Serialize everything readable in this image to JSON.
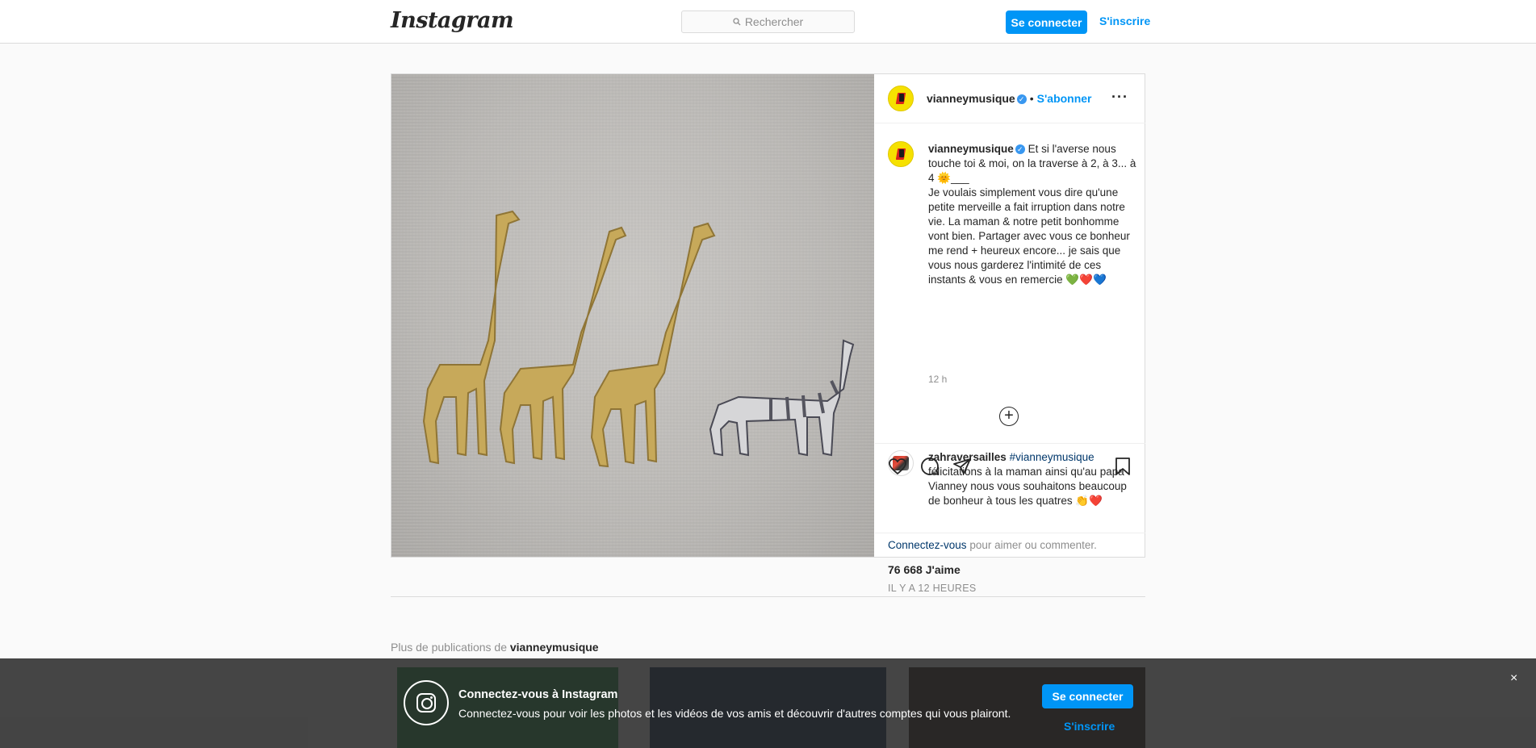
{
  "header": {
    "logo": "Instagram",
    "search_placeholder": "Rechercher",
    "login_label": "Se connecter",
    "signup_label": "S'inscrire"
  },
  "post": {
    "username": "vianneymusique",
    "follow_label": "S'abonner",
    "caption_user": "vianneymusique",
    "caption_line1": "Et si l'averse nous touche toi & moi, on la traverse à 2, à 3... à 4 🌞___",
    "caption_body": "Je voulais simplement vous dire qu'une petite merveille a fait irruption dans notre vie. La maman & notre petit bonhomme vont bien. Partager avec vous ce bonheur me rend + heureux encore... je sais que vous nous garderez l'intimité de ces instants & vous en remercie 💚❤️💙",
    "caption_time": "12 h",
    "comment": {
      "username": "zahraversailles",
      "hashtag": "#vianneymusique",
      "text": "félicitations à la maman ainsi qu'au papa Vianney nous vous souhaitons beaucoup de bonheur à tous les quatres 👏❤️"
    },
    "likes": "76 668 J'aime",
    "posted": "IL Y A 12 HEURES",
    "login_prompt_link": "Connectez-vous",
    "login_prompt_rest": " pour aimer ou commenter."
  },
  "more_posts": {
    "prefix": "Plus de publications de ",
    "username": "vianneymusique"
  },
  "banner": {
    "title": "Connectez-vous à Instagram",
    "text": "Connectez-vous pour voir les photos et les vidéos de vos amis et découvrir d'autres comptes qui vous plairont.",
    "login_label": "Se connecter",
    "signup_label": "S'inscrire",
    "close": "×"
  },
  "colors": {
    "accent": "#0095f6",
    "link_dark": "#00376b",
    "verified": "#3897f0"
  }
}
